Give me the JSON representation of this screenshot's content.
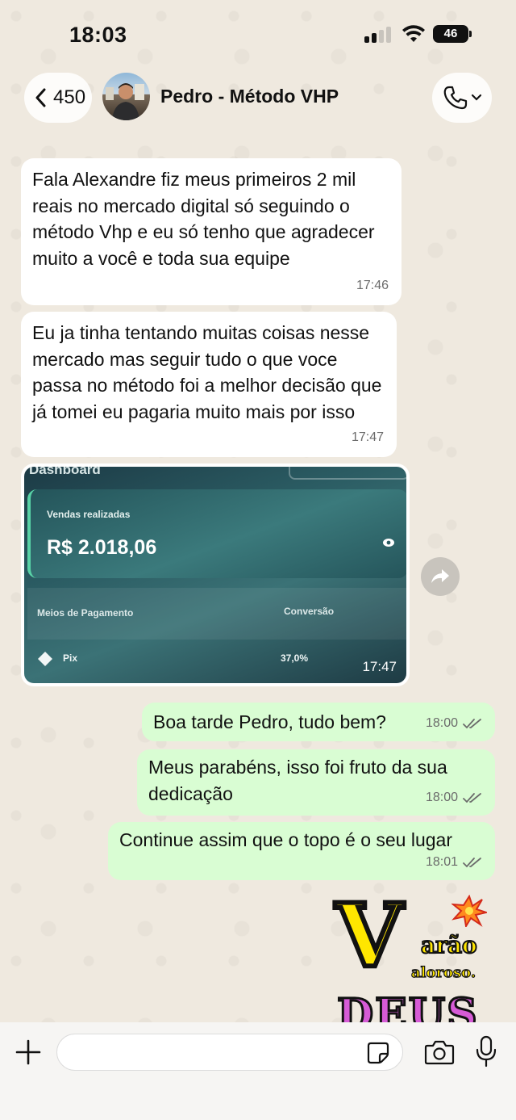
{
  "status_bar": {
    "time": "18:03",
    "battery": "46"
  },
  "header": {
    "back_count": "450",
    "contact_name": "Pedro - Método VHP"
  },
  "messages": [
    {
      "direction": "incoming",
      "text": "Fala Alexandre fiz meus primeiros 2 mil reais no mercado digital só seguindo o método Vhp e eu só tenho que agradecer muito a você e toda sua equipe",
      "time": "17:46"
    },
    {
      "direction": "incoming",
      "text": "Eu ja tinha tentando muitas coisas nesse mercado mas seguir tudo o que voce passa no método foi a melhor decisão que já tomei eu pagaria muito mais por isso",
      "time": "17:47"
    },
    {
      "direction": "incoming",
      "type": "image",
      "time": "17:47",
      "image": {
        "dashboard_label": "Dashboard",
        "sales_label": "Vendas realizadas",
        "sales_value": "R$ 2.018,06",
        "payment_label": "Meios de Pagamento",
        "conversion_label": "Conversão",
        "pix_label": "Pix",
        "pix_conversion": "37,0%"
      }
    },
    {
      "direction": "outgoing",
      "text": "Boa tarde Pedro, tudo bem?",
      "time": "18:00"
    },
    {
      "direction": "outgoing",
      "text": "Meus parabéns, isso foi fruto da sua dedicação",
      "time": "18:00"
    },
    {
      "direction": "outgoing",
      "text": "Continue assim que o topo é o seu lugar",
      "time": "18:01"
    }
  ],
  "sticker": {
    "big_letter": "V",
    "word1": "arão",
    "word2": "aloroso.",
    "word3": "DEUS"
  },
  "input": {
    "value": "",
    "placeholder": ""
  },
  "icons": {
    "back": "chevron-left-icon",
    "call": "phone-icon",
    "forward": "forward-icon",
    "plus": "plus-icon",
    "sticker": "sticker-icon",
    "camera": "camera-icon",
    "mic": "microphone-icon"
  },
  "colors": {
    "outgoing_bubble": "#d9fdd3",
    "incoming_bubble": "#ffffff",
    "chat_background": "#efeae2",
    "read_ticks": "#6b6b6b"
  }
}
